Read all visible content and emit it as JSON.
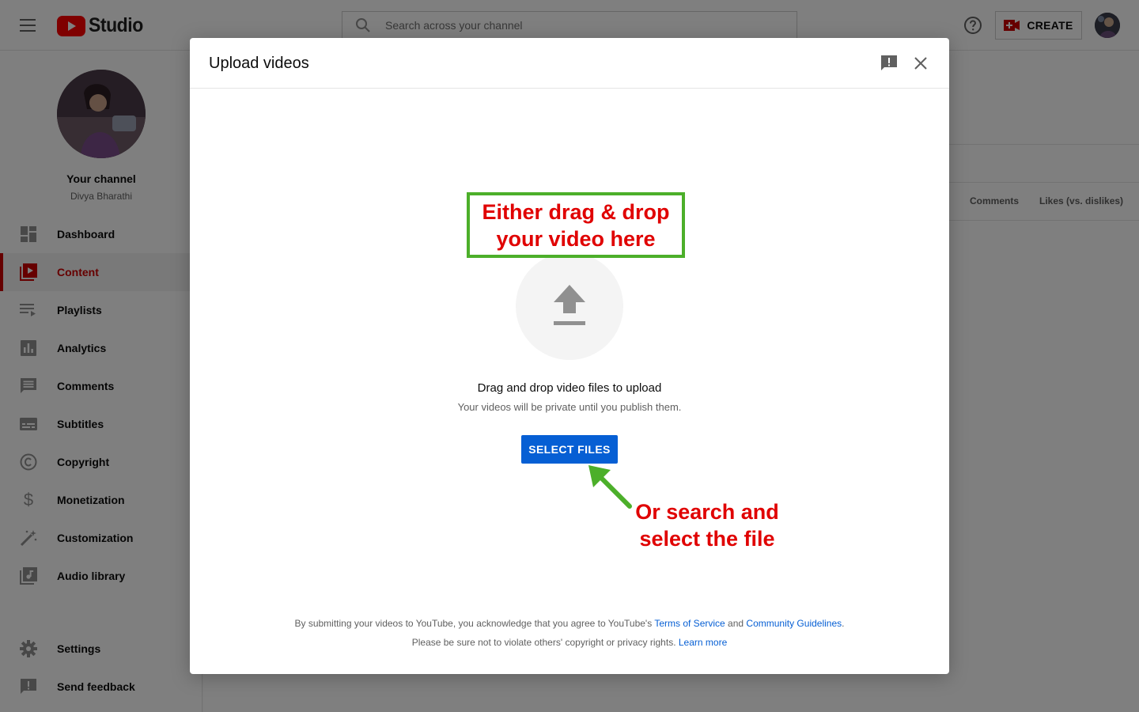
{
  "app": {
    "name": "Studio"
  },
  "topbar": {
    "search_placeholder": "Search across your channel",
    "create_label": "CREATE"
  },
  "sidebar": {
    "channel_title": "Your channel",
    "channel_name": "Divya Bharathi",
    "items": [
      {
        "label": "Dashboard",
        "icon": "dashboard-icon"
      },
      {
        "label": "Content",
        "icon": "content-icon",
        "active": true
      },
      {
        "label": "Playlists",
        "icon": "playlists-icon"
      },
      {
        "label": "Analytics",
        "icon": "analytics-icon"
      },
      {
        "label": "Comments",
        "icon": "comments-icon"
      },
      {
        "label": "Subtitles",
        "icon": "subtitles-icon"
      },
      {
        "label": "Copyright",
        "icon": "copyright-icon"
      },
      {
        "label": "Monetization",
        "icon": "dollar-icon"
      },
      {
        "label": "Customization",
        "icon": "magic-wand-icon"
      },
      {
        "label": "Audio library",
        "icon": "audio-library-icon"
      }
    ],
    "bottom_items": [
      {
        "label": "Settings",
        "icon": "gear-icon"
      },
      {
        "label": "Send feedback",
        "icon": "feedback-icon"
      }
    ]
  },
  "background": {
    "columns": [
      "Comments",
      "Likes (vs. dislikes)"
    ]
  },
  "dialog": {
    "title": "Upload videos",
    "drop_title": "Drag and drop video files to upload",
    "drop_subtitle": "Your videos will be private until you publish them.",
    "select_button": "SELECT FILES",
    "legal_line1_prefix": "By submitting your videos to YouTube, you acknowledge that you agree to YouTube's",
    "terms_link": "Terms of Service",
    "and_text": "and",
    "guidelines_link": "Community Guidelines",
    "period": ".",
    "legal_line2_prefix": "Please be sure not to violate others' copyright or privacy rights.",
    "learn_more_link": "Learn more"
  },
  "annotations": {
    "box_line1": "Either drag & drop",
    "box_line2": "your video here",
    "arrow_line1": "Or search and",
    "arrow_line2": "select the file"
  },
  "colors": {
    "brand_red": "#ff0000",
    "active_red": "#cc0000",
    "link_blue": "#065fd4",
    "annotation_green": "#4caf2a",
    "annotation_red": "#e00000"
  }
}
